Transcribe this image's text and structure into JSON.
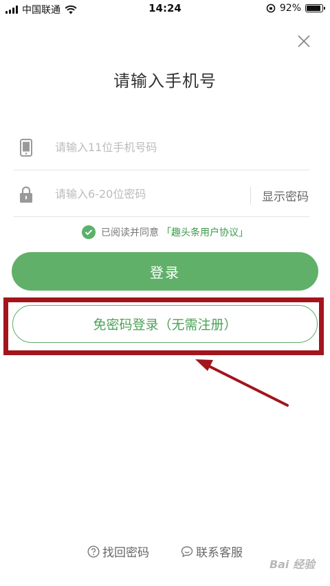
{
  "status_bar": {
    "carrier": "中国联通",
    "time": "14:24",
    "battery_percent": "92%",
    "battery_level": 0.92
  },
  "header": {
    "title": "请输入手机号",
    "close_icon": "close-icon"
  },
  "form": {
    "phone_placeholder": "请输入11位手机号码",
    "phone_value": "",
    "password_placeholder": "请输入6-20位密码",
    "password_value": "",
    "show_password_label": "显示密码",
    "agreement_text": "已阅读并同意",
    "agreement_link": "「趣头条用户协议」",
    "agreement_checked": true
  },
  "buttons": {
    "login_label": "登录",
    "passwordless_label": "免密码登录（无需注册）"
  },
  "footer": {
    "recover_password": "找回密码",
    "contact_service": "联系客服"
  },
  "watermark": "Bai 经验",
  "colors": {
    "accent_green": "#61b069",
    "highlight_red": "#a3141c"
  }
}
